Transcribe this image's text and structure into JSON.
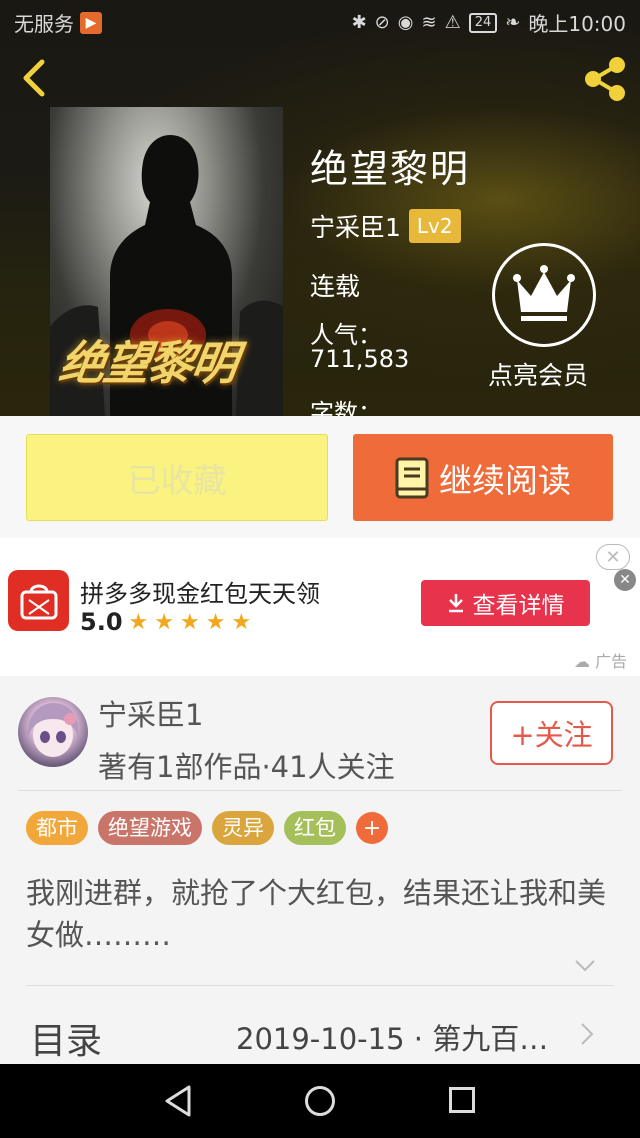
{
  "status_bar": {
    "carrier": "无服务",
    "time": "晚上10:00",
    "battery": "24"
  },
  "book": {
    "cover_title": "绝望黎明",
    "title": "绝望黎明",
    "author": "宁采臣1",
    "level": "Lv2",
    "status": "连载",
    "popularity_label": "人气：",
    "popularity_value": "711,583",
    "word_count_label": "字数："
  },
  "vip": {
    "label": "点亮会员"
  },
  "actions": {
    "collected_label": "已收藏",
    "read_label": "继续阅读"
  },
  "ad": {
    "title": "拼多多现金红包天天领",
    "score": "5.0",
    "stars": 5,
    "button_label": "查看详情",
    "tag": "广告",
    "close": "✕",
    "close2": "✕",
    "accent_color": "#e8334d"
  },
  "author_section": {
    "name": "宁采臣1",
    "meta": "著有1部作品·41人关注",
    "follow_label": "+关注",
    "tags": [
      {
        "label": "都市",
        "color": "#f2a73a"
      },
      {
        "label": "绝望游戏",
        "color": "#c9756a"
      },
      {
        "label": "灵异",
        "color": "#d9a53c"
      },
      {
        "label": "红包",
        "color": "#a5c05a"
      }
    ],
    "tag_more": "+",
    "intro": "我刚进群，就抢了个大红包，结果还让我和美女做………",
    "toc_label": "目录",
    "toc_latest": "2019-10-15 · 第九百…"
  }
}
